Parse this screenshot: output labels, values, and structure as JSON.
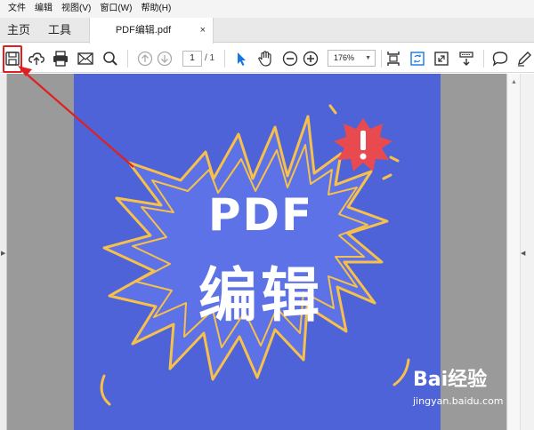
{
  "menu": [
    "文件",
    "编辑",
    "视图(V)",
    "窗口(W)",
    "帮助(H)"
  ],
  "tabs": {
    "home": "主页",
    "tools": "工具",
    "document_title": "PDF编辑.pdf",
    "close_glyph": "×"
  },
  "toolbar": {
    "icons": [
      "save-icon",
      "upload-cloud-icon",
      "print-icon",
      "email-icon",
      "search-icon",
      "page-up-icon",
      "page-down-icon",
      "select-arrow-icon",
      "hand-tool-icon",
      "zoom-out-icon",
      "zoom-in-icon",
      "fit-page-icon",
      "rotate-icon",
      "full-screen-icon",
      "read-mode-icon",
      "comment-icon",
      "pen-icon"
    ],
    "page_current": "1",
    "page_total": "/ 1",
    "zoom": "176%"
  },
  "document": {
    "line1": "PDF",
    "line2": "编辑",
    "background": "#4f63d8",
    "burst_color": "#f7c04a",
    "alert_color": "#e84a4f"
  },
  "watermark": {
    "logo": "Bai经验",
    "url": "jingyan.baidu.com"
  },
  "colors": {
    "highlight": "#e02020",
    "pointer": "#1677e0"
  }
}
